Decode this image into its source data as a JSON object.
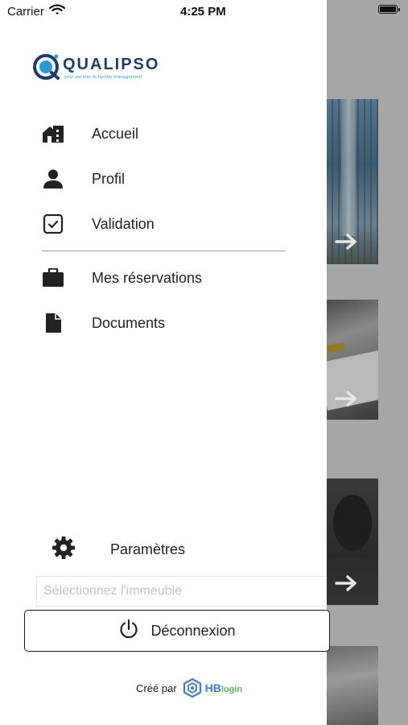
{
  "status_bar": {
    "carrier": "Carrier",
    "time": "4:25 PM"
  },
  "logo": {
    "name": "QUALIPSO",
    "tagline": "your partner in facility management"
  },
  "menu": {
    "items": [
      {
        "label": "Accueil",
        "icon": "home-icon"
      },
      {
        "label": "Profil",
        "icon": "person-icon"
      },
      {
        "label": "Validation",
        "icon": "check-box-icon"
      },
      {
        "label": "Mes réservations",
        "icon": "briefcase-icon"
      },
      {
        "label": "Documents",
        "icon": "document-icon"
      }
    ]
  },
  "settings": {
    "label": "Paramètres",
    "icon": "gear-icon"
  },
  "building_select": {
    "placeholder": "Sélectionnez l'immeuble",
    "value": ""
  },
  "logout": {
    "label": "Déconnexion",
    "icon": "power-icon"
  },
  "credit": {
    "label": "Créé par",
    "brand_main": "HB",
    "brand_sub": "login"
  },
  "colors": {
    "brand_blue": "#1d3b6b",
    "accent_blue": "#2a9ad6",
    "hb_blue": "#3a7ad4",
    "hb_green": "#5cb85c"
  }
}
